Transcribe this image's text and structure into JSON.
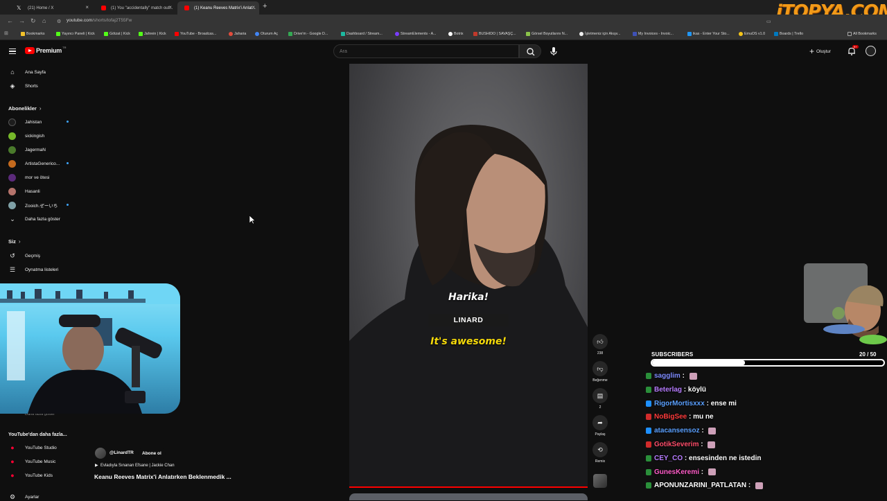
{
  "tabs": [
    {
      "label": "(21) Home / X",
      "icon_color": "#000000"
    },
    {
      "label": "(1) You \"accidentally\" match out...",
      "icon_color": "#ff0000"
    },
    {
      "label": "(1) Keanu Reeves Matrix'i Anlat...",
      "icon_color": "#ff0000"
    }
  ],
  "watermark": "iTOPYA.COM",
  "address": {
    "host": "youtube.com",
    "path": "/shorts/tofaj2T55Fw"
  },
  "bookmarks": [
    "Bookmarks",
    "Yayıncı Paneli | Kick",
    "Götzat | Kick",
    "Jahrein | Kick",
    "YouTube - Broadcas...",
    "Jaharia",
    "Oturum Aç",
    "Drive'm - Google D...",
    "Dashboard / Stream...",
    "StreamElements - A...",
    "Botrix",
    "BUSHIDO | SAVAŞÇ...",
    "Görsel Boyutlarını N...",
    "İşletmeniz için Akışv...",
    "My Invoices - Invoic...",
    "ikas - Enter Your Sto...",
    "EmuOS v1.0",
    "Boards | Trello",
    "All Bookmarks"
  ],
  "header": {
    "logo_text": "Premium",
    "logo_sup": "TR",
    "search_placeholder": "Ara",
    "create_label": "Oluştur",
    "notif_count": "9+"
  },
  "sidebar": {
    "main": [
      "Ana Sayfa",
      "Shorts"
    ],
    "subs_header": "Abonelikler",
    "subs": [
      {
        "name": "Jahistan",
        "color": "#1d1d1d"
      },
      {
        "name": "sickingish",
        "color": "#76b82a"
      },
      {
        "name": "JagermaN",
        "color": "#4a7a2b"
      },
      {
        "name": "ArtistaGenerico...",
        "color": "#c46a1e"
      },
      {
        "name": "mor ve ötesi",
        "color": "#5b2a7a"
      },
      {
        "name": "Hasanli",
        "color": "#b5736b"
      },
      {
        "name": "Zooich.ぜーいち",
        "color": "#7fa0a6"
      }
    ],
    "more": "Daha fazla göster",
    "you_header": "Siz",
    "you": [
      "Geçmiş",
      "Oynatma listeleri"
    ],
    "hidden_more": "Daha fazla göster",
    "explore_header": "YouTube'dan daha fazla...",
    "explore": [
      "YouTube Studio",
      "YouTube Music",
      "YouTube Kids"
    ],
    "settings": "Ayarlar"
  },
  "video": {
    "caption_tr": "Harika!",
    "speaker": "LINARD",
    "caption_en": "It's awesome!",
    "channel": "@LinardTR",
    "subscribe": "Abone ol",
    "song": "Evladıyla Sınanan Efsane | Jackie Chan",
    "title": "Keanu Reeves Matrix'i Anlatırken Beklenmedik ..."
  },
  "actions": [
    {
      "icon": "like-icon",
      "label": "238"
    },
    {
      "icon": "dislike-icon",
      "label": "Beğenme"
    },
    {
      "icon": "comment-icon",
      "label": "2"
    },
    {
      "icon": "share-icon",
      "label": "Paylaş"
    },
    {
      "icon": "remix-icon",
      "label": "Remix"
    }
  ],
  "subscribers": {
    "label": "SUBSCRIBERS",
    "count": "20 / 50",
    "current": 20,
    "goal": 50
  },
  "chat": [
    {
      "user": "sagglim",
      "msg": "",
      "color": "#7e8cff",
      "badge": "#2a8f3a",
      "emote": true
    },
    {
      "user": "Beterlag",
      "msg": "köylü",
      "color": "#b77cff",
      "badge": "#2a8f3a",
      "emote": false
    },
    {
      "user": "RigorMortisxxx",
      "msg": "ense mi",
      "color": "#5aa0ff",
      "badge": "#1e90ff",
      "emote": false
    },
    {
      "user": "NoBigSee",
      "msg": "mu ne",
      "color": "#ff3b3b",
      "badge": "#d12b2b",
      "emote": false
    },
    {
      "user": "atacansensoz",
      "msg": "",
      "color": "#5aa0ff",
      "badge": "#1e90ff",
      "emote": true
    },
    {
      "user": "GotikSeverim",
      "msg": "",
      "color": "#ff4d6a",
      "badge": "#d12b2b",
      "emote": true
    },
    {
      "user": "CEY_CO",
      "msg": "ensesinden ne istedin",
      "color": "#b77cff",
      "badge": "#2a8f3a",
      "emote": false
    },
    {
      "user": "GunesKeremi",
      "msg": "",
      "color": "#ff5cc8",
      "badge": "#2a8f3a",
      "emote": true
    },
    {
      "user": "APONUNZARINI_PATLATAN",
      "msg": "",
      "color": "#ffffff",
      "badge": "#2a8f3a",
      "emote": true
    }
  ]
}
